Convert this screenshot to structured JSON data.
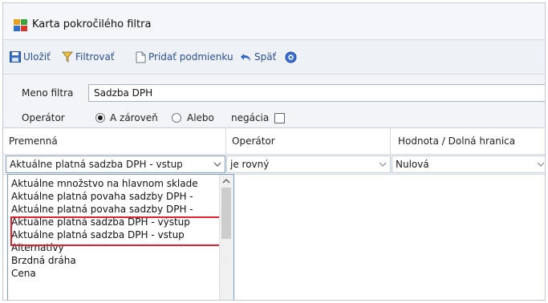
{
  "window": {
    "title": "Karta pokročilého filtra",
    "icon": "filter-app-icon"
  },
  "toolbar": {
    "save": "Uložiť",
    "filter": "Filtrovať",
    "add_condition": "Pridať podmienku",
    "back": "Späť",
    "help_icon": "help-icon"
  },
  "form": {
    "name_label": "Meno filtra",
    "name_value": "Sadzba DPH",
    "operator_label": "Operátor",
    "option_and": "A zároveň",
    "option_or": "Alebo",
    "negation": "negácia",
    "selected_option": "A zároveň",
    "negation_checked": false
  },
  "grid": {
    "headers": [
      "Premenná",
      "Operátor",
      "Hodnota / Dolná hranica"
    ],
    "row": {
      "variable": "Aktuálne platná sadzba DPH - vstup",
      "operator": "je rovný",
      "value": "Nulová"
    }
  },
  "dropdown": {
    "items": [
      "Aktuálne množstvo na hlavnom sklade",
      "Aktuálne platná povaha sadzby DPH -",
      "Aktuálne platná povaha sadzby DPH -",
      "Aktuálne platná sadzba  DPH - výstup",
      "Aktuálne platná sadzba DPH - vstup",
      "Alternatívy",
      "Brzdná dráha",
      "Cena"
    ],
    "highlighted_items": [
      "Aktuálne platná sadzba  DPH - výstup",
      "Aktuálne platná sadzba DPH - vstup"
    ],
    "highlight_color": "#e0202b"
  },
  "colors": {
    "toolbar_text": "#2b4f91",
    "accent": "#7a9cc6"
  }
}
